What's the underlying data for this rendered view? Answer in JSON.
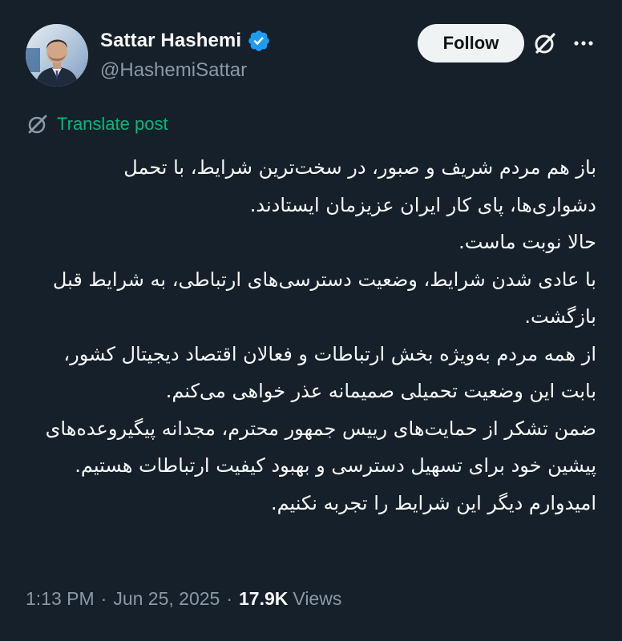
{
  "author": {
    "display_name": "Sattar Hashemi",
    "handle": "@HashemiSattar",
    "verified": true
  },
  "actions": {
    "follow_label": "Follow",
    "grok_icon": "grok-icon",
    "more_icon": "more-icon"
  },
  "translate": {
    "label": "Translate post",
    "icon": "translate-icon"
  },
  "tweet": {
    "text": "باز هم مردم شریف و صبور، در سخت‌ترین شرایط، با تحمل دشواری‌ها، پای کار ایران عزیزمان ایستادند.\nحالا نوبت ماست.\nبا عادی شدن شرایط، وضعیت دسترسی‌های ارتباطی، به شرایط قبل بازگشت.\nاز همه مردم به‌ویژه بخش ارتباطات و فعالان اقتصاد دیجیتال کشور، بابت این وضعیت تحمیلی صمیمانه عذر خواهی می‌کنم.\nضمن تشکر از حمایت‌های رییس جمهور محترم، مجدانه پیگیروعده‌های پیشین خود برای تسهیل دسترسی و بهبود کیفیت ارتباطات هستیم. امیدوارم دیگر این شرایط را تجربه نکنیم."
  },
  "meta": {
    "time": "1:13 PM",
    "separator": "·",
    "date": "Jun 25, 2025",
    "views_count": "17.9K",
    "views_label": "Views"
  },
  "colors": {
    "background": "#15202b",
    "text": "#f7f9f9",
    "secondary": "#8b98a5",
    "translate": "#00ba7c",
    "verified": "#1d9bf0",
    "follow_bg": "#eff3f4"
  }
}
